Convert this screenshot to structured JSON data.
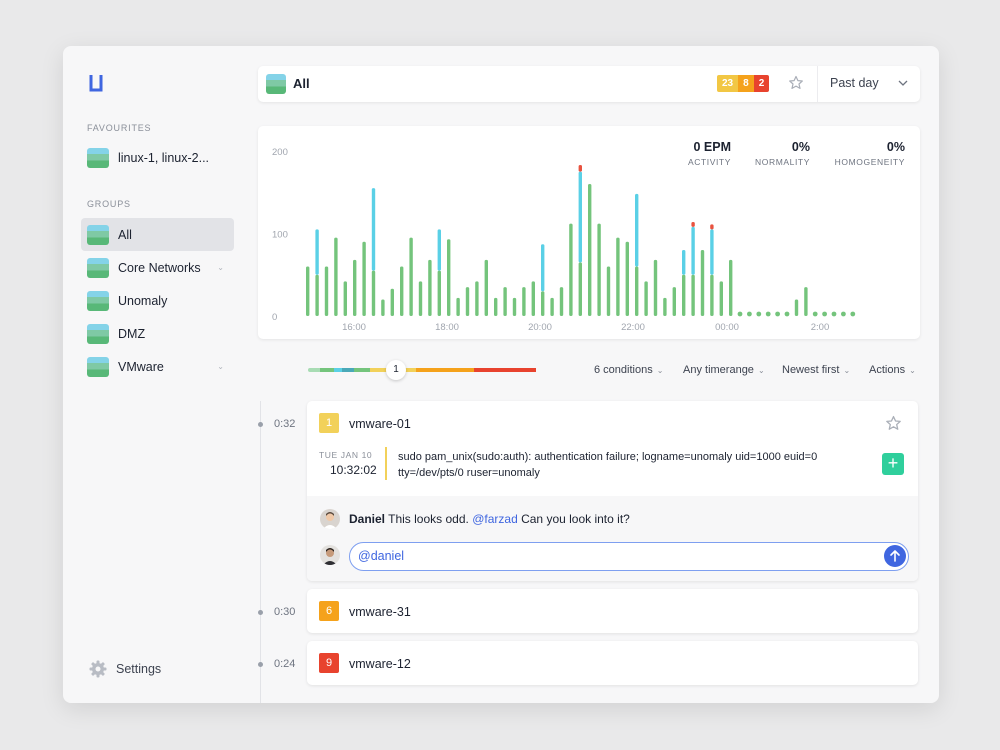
{
  "sidebar": {
    "favourites_label": "FAVOURITES",
    "favourites": [
      {
        "label": "linux-1, linux-2..."
      }
    ],
    "groups_label": "GROUPS",
    "groups": [
      {
        "label": "All",
        "active": true
      },
      {
        "label": "Core Networks",
        "expandable": true
      },
      {
        "label": "Unomaly"
      },
      {
        "label": "DMZ"
      },
      {
        "label": "VMware",
        "expandable": true
      }
    ],
    "settings_label": "Settings"
  },
  "topbar": {
    "title": "All",
    "badges": [
      {
        "value": "23",
        "color": "#f2c744"
      },
      {
        "value": "8",
        "color": "#f5a21b"
      },
      {
        "value": "2",
        "color": "#e8432e"
      }
    ],
    "timerange": "Past day"
  },
  "metrics": [
    {
      "value": "0 EPM",
      "label": "ACTIVITY"
    },
    {
      "value": "0%",
      "label": "NORMALITY"
    },
    {
      "value": "0%",
      "label": "HOMOGENEITY"
    }
  ],
  "chart_data": {
    "type": "bar",
    "y_ticks": [
      "200",
      "100",
      "0"
    ],
    "x_ticks": [
      "16:00",
      "18:00",
      "20:00",
      "22:00",
      "00:00",
      "2:00"
    ],
    "ylim": [
      0,
      200
    ],
    "colors": {
      "green": "#74c47c",
      "blue": "#5ad0e6",
      "red": "#e8523f"
    },
    "series_names": [
      "green",
      "blue",
      "red"
    ],
    "values": [
      [
        60,
        0,
        0
      ],
      [
        50,
        55,
        0
      ],
      [
        60,
        0,
        0
      ],
      [
        95,
        0,
        0
      ],
      [
        42,
        0,
        0
      ],
      [
        68,
        0,
        0
      ],
      [
        90,
        0,
        0
      ],
      [
        55,
        100,
        0
      ],
      [
        20,
        0,
        0
      ],
      [
        33,
        0,
        0
      ],
      [
        60,
        0,
        0
      ],
      [
        95,
        0,
        0
      ],
      [
        42,
        0,
        0
      ],
      [
        68,
        0,
        0
      ],
      [
        55,
        50,
        0
      ],
      [
        93,
        0,
        0
      ],
      [
        22,
        0,
        0
      ],
      [
        35,
        0,
        0
      ],
      [
        42,
        0,
        0
      ],
      [
        68,
        0,
        0
      ],
      [
        22,
        0,
        0
      ],
      [
        35,
        0,
        0
      ],
      [
        22,
        0,
        0
      ],
      [
        35,
        0,
        0
      ],
      [
        42,
        0,
        0
      ],
      [
        30,
        57,
        0
      ],
      [
        22,
        0,
        0
      ],
      [
        35,
        0,
        0
      ],
      [
        112,
        0,
        0
      ],
      [
        65,
        110,
        8
      ],
      [
        160,
        0,
        0
      ],
      [
        112,
        0,
        0
      ],
      [
        60,
        0,
        0
      ],
      [
        95,
        0,
        0
      ],
      [
        90,
        0,
        0
      ],
      [
        60,
        88,
        0
      ],
      [
        42,
        0,
        0
      ],
      [
        68,
        0,
        0
      ],
      [
        22,
        0,
        0
      ],
      [
        35,
        0,
        0
      ],
      [
        50,
        30,
        0
      ],
      [
        50,
        58,
        6
      ],
      [
        80,
        0,
        0
      ],
      [
        50,
        55,
        6
      ],
      [
        42,
        0,
        0
      ],
      [
        68,
        0,
        0
      ],
      [
        5,
        0,
        0
      ],
      [
        8,
        0,
        0
      ],
      [
        5,
        0,
        0
      ],
      [
        8,
        0,
        0
      ],
      [
        5,
        0,
        0
      ],
      [
        8,
        0,
        0
      ],
      [
        20,
        0,
        0
      ],
      [
        35,
        0,
        0
      ],
      [
        5,
        0,
        0
      ],
      [
        8,
        0,
        0
      ],
      [
        5,
        0,
        0
      ],
      [
        8,
        0,
        0
      ],
      [
        5,
        0,
        0
      ]
    ]
  },
  "scrubber": {
    "knob_label": "1",
    "colors": [
      "#a8dcb4",
      "#74c47c",
      "#5ad0e6",
      "#4aa9b8",
      "#74c47c",
      "#f2d15a",
      "#f5a21b",
      "#e8432e"
    ]
  },
  "filters": [
    {
      "label": "6 conditions"
    },
    {
      "label": "Any timerange"
    },
    {
      "label": "Newest first"
    },
    {
      "label": "Actions"
    }
  ],
  "events": [
    {
      "time": "0:32",
      "severity": "1",
      "severity_color": "#f2d15a",
      "title": "vmware-01",
      "log_date": "TUE JAN 10",
      "log_time": "10:32:02",
      "log_message": "sudo pam_unix(sudo:auth): authentication failure; logname=unomaly uid=1000 euid=0 tty=/dev/pts/0 ruser=unomaly",
      "comment_author": "Daniel",
      "comment_before": "This looks odd.",
      "comment_mention": "@farzad",
      "comment_after": "Can you look into it?",
      "reply_text": "@daniel"
    },
    {
      "time": "0:30",
      "severity": "6",
      "severity_color": "#f5a21b",
      "title": "vmware-31"
    },
    {
      "time": "0:24",
      "severity": "9",
      "severity_color": "#e8432e",
      "title": "vmware-12"
    }
  ]
}
